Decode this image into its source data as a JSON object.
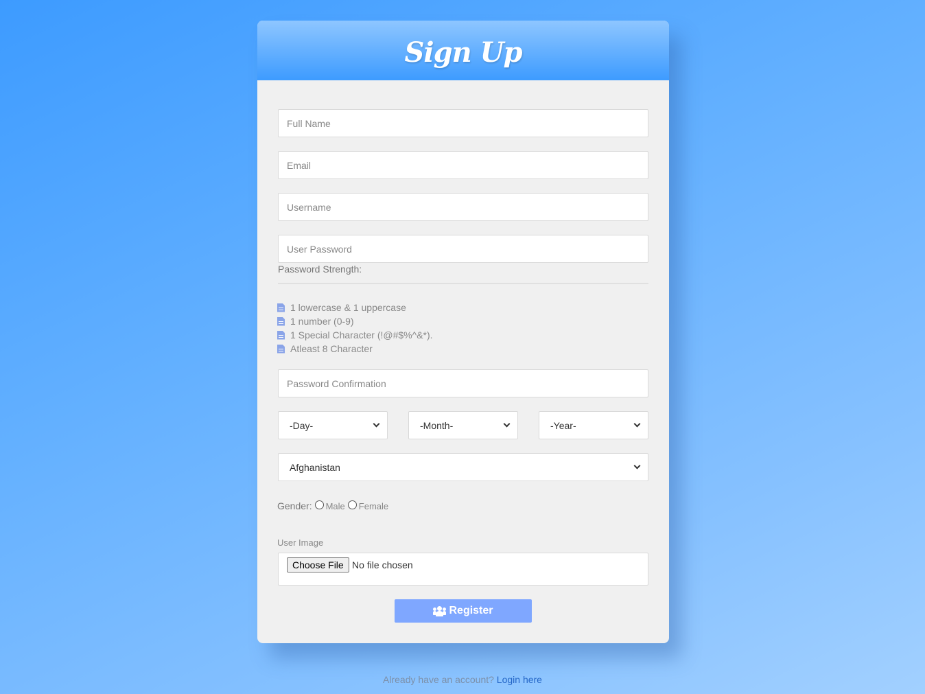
{
  "title": "Sign Up",
  "fields": {
    "full_name_placeholder": "Full Name",
    "email_placeholder": "Email",
    "username_placeholder": "Username",
    "password_placeholder": "User Password",
    "password_confirm_placeholder": "Password Confirmation"
  },
  "password_strength_label": "Password Strength:",
  "password_rules": [
    "1 lowercase & 1 uppercase",
    "1 number (0-9)",
    "1 Special Character (!@#$%^&*).",
    "Atleast 8 Character"
  ],
  "dob": {
    "day": "-Day-",
    "month": "-Month-",
    "year": "-Year-"
  },
  "country": "Afghanistan",
  "gender": {
    "label": "Gender:",
    "male": "Male",
    "female": "Female"
  },
  "user_image": {
    "label": "User Image",
    "button": "Choose File",
    "status": "No file chosen"
  },
  "register_button": "Register",
  "footer": {
    "text": "Already have an account?",
    "link": "Login here"
  },
  "colors": {
    "accent": "#3d9bff",
    "button": "#7fa7ff",
    "link": "#2466c7"
  },
  "icons": {
    "rule": "document-icon",
    "register": "users-icon"
  }
}
